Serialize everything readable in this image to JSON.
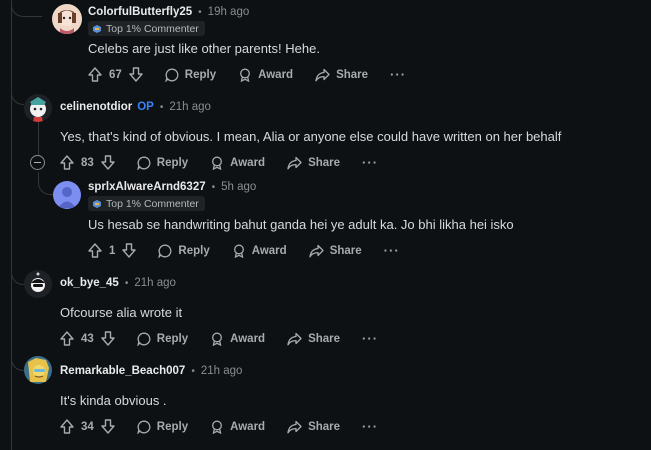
{
  "comments": [
    {
      "username": "ColorfulButterfly25",
      "time": "19h ago",
      "flair": "Top 1% Commenter",
      "text": "Celebs are just like other parents! Hehe.",
      "votes": "67"
    },
    {
      "username": "celinenotdior",
      "op_badge": "OP",
      "time": "21h ago",
      "text": "Yes, that's kind of obvious. I mean, Alia or anyone else could have written on her behalf",
      "votes": "83"
    },
    {
      "username": "sprlxAlwareArnd6327",
      "time": "5h ago",
      "flair": "Top 1% Commenter",
      "text": "Us hesab se handwriting bahut ganda hei ye adult ka. Jo bhi likha hei isko",
      "votes": "1"
    },
    {
      "username": "ok_bye_45",
      "time": "21h ago",
      "text": "Ofcourse alia wrote it",
      "votes": "43"
    },
    {
      "username": "Remarkable_Beach007",
      "time": "21h ago",
      "text": "It's kinda obvious .",
      "votes": "34"
    }
  ],
  "actions": {
    "reply": "Reply",
    "award": "Award",
    "share": "Share",
    "more": "···",
    "separator": "•"
  },
  "colors": {
    "background": "#0e1113",
    "op_badge": "#3b82f6",
    "thread_line": "#343536"
  },
  "icons": [
    "upvote-icon",
    "downvote-icon",
    "reply-bubble-icon",
    "award-icon",
    "share-arrow-icon",
    "collapse-minus-icon",
    "flair-icon"
  ]
}
